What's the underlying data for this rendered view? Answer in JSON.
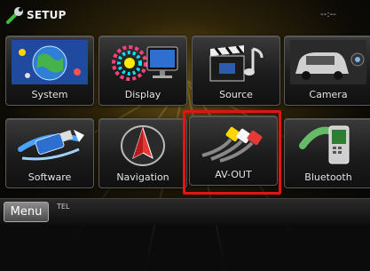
{
  "header": {
    "title": "SETUP",
    "clock": "--:--"
  },
  "tiles": [
    {
      "label": "System",
      "icon": "system-globe-icon"
    },
    {
      "label": "Display",
      "icon": "display-monitor-icon"
    },
    {
      "label": "Source",
      "icon": "source-clapper-icon"
    },
    {
      "label": "Camera",
      "icon": "camera-car-icon"
    },
    {
      "label": "Software",
      "icon": "software-usb-icon"
    },
    {
      "label": "Navigation",
      "icon": "navigation-arrow-icon"
    },
    {
      "label": "AV-OUT",
      "icon": "av-out-cable-icon"
    },
    {
      "label": "Bluetooth",
      "icon": "bluetooth-phone-icon"
    }
  ],
  "selected_tile": "AV-OUT",
  "footer": {
    "menu_label": "Menu",
    "tel_label": "TEL"
  },
  "colors": {
    "selection": "#e31414",
    "background_glow": "#6a5418"
  }
}
